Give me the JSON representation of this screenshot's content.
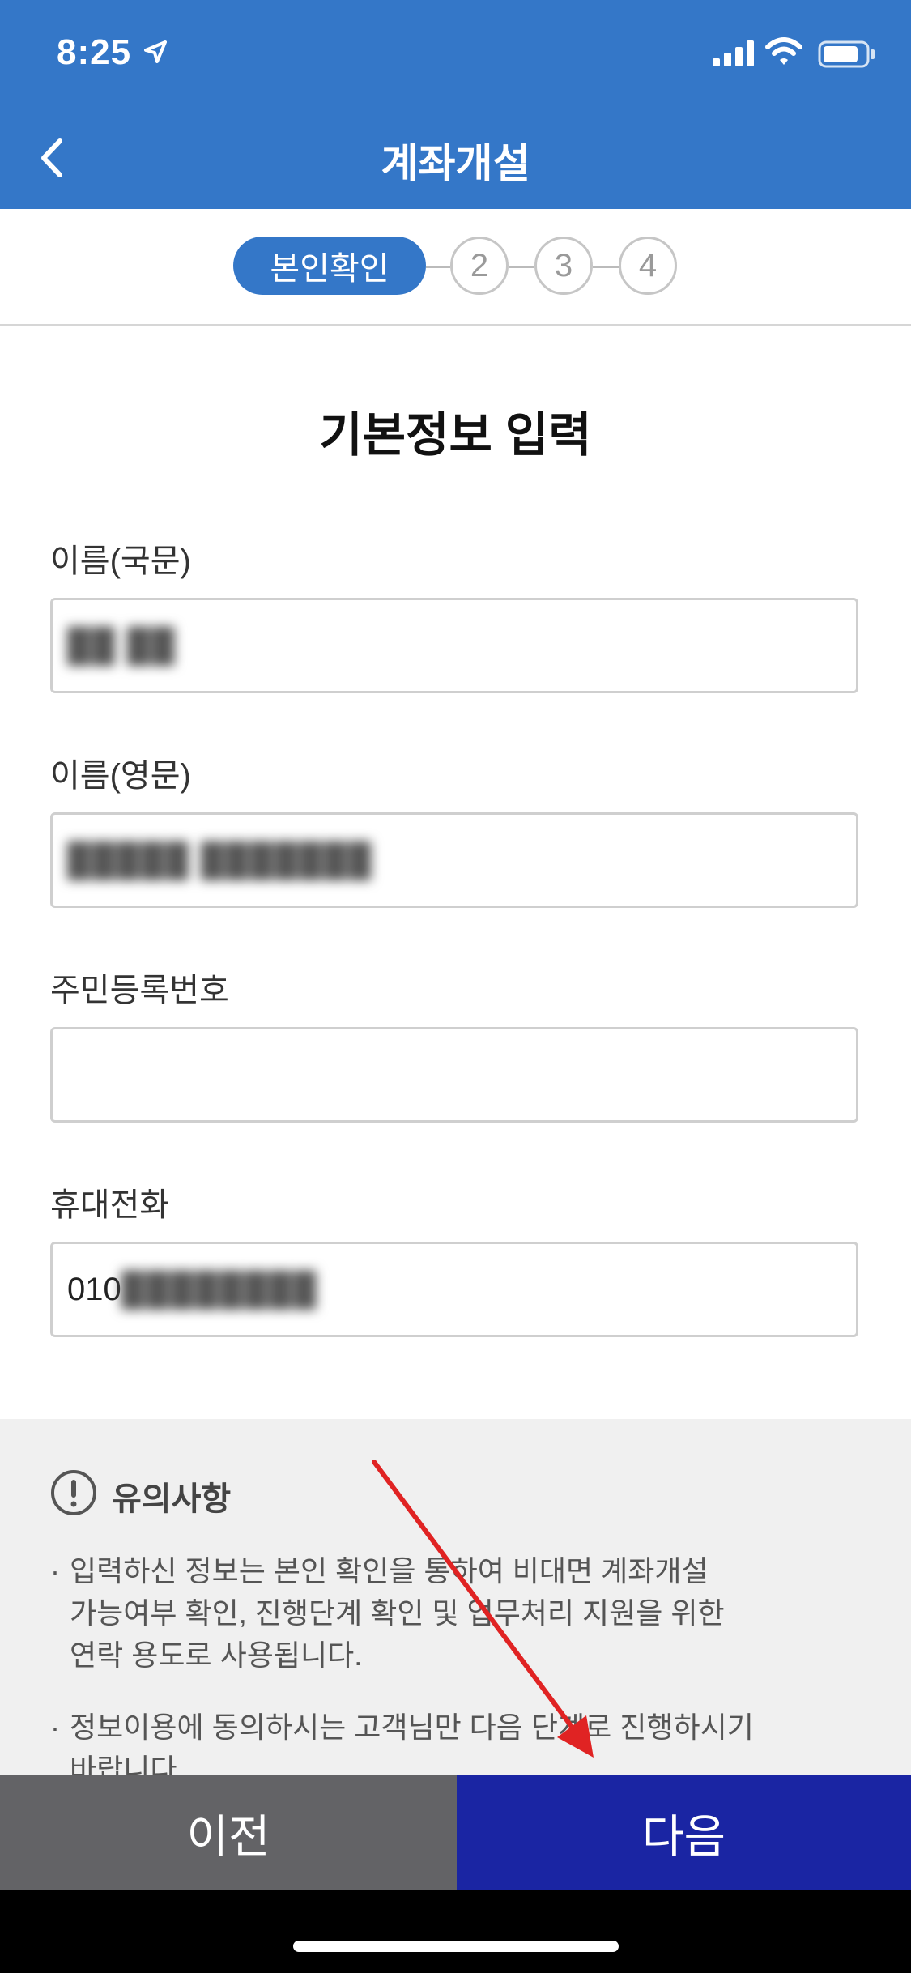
{
  "status_bar": {
    "time": "8:25"
  },
  "header": {
    "title": "계좌개설",
    "back_icon": "chevron-left-icon"
  },
  "stepper": {
    "active_label": "본인확인",
    "steps": [
      "2",
      "3",
      "4"
    ]
  },
  "form": {
    "section_title": "기본정보 입력",
    "fields": [
      {
        "label": "이름(국문)",
        "value": "██ ██"
      },
      {
        "label": "이름(영문)",
        "value": "█████ ███████"
      },
      {
        "label": "주민등록번호",
        "value": ""
      },
      {
        "label": "휴대전화",
        "value_prefix": "010",
        "value_redacted": "████████"
      }
    ]
  },
  "notice": {
    "icon": "exclamation-circle-icon",
    "title": "유의사항",
    "items": [
      [
        "입력하신 정보는 본인 확인을 통하여 비대면 계좌개설",
        "가능여부 확인, 진행단계 확인 및 업무처리 지원을 위한",
        "연락 용도로 사용됩니다."
      ],
      [
        "정보이용에 동의하시는 고객님만 다음 단계로 진행하시기",
        "바랍니다."
      ]
    ]
  },
  "buttons": {
    "prev": "이전",
    "next": "다음"
  },
  "colors": {
    "primary": "#3477c8",
    "next_button": "#1a25a3",
    "prev_button": "#636366",
    "annotation_arrow": "#e02323"
  }
}
